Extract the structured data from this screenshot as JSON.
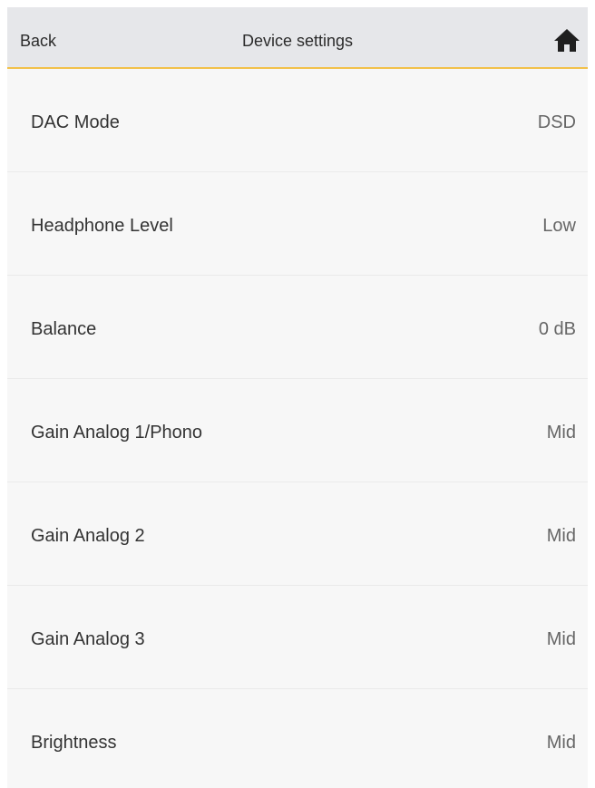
{
  "navbar": {
    "back_label": "Back",
    "title": "Device settings",
    "home_icon": "home-icon",
    "accent_color": "#f2c14a"
  },
  "settings": [
    {
      "label": "DAC Mode",
      "value": "DSD"
    },
    {
      "label": "Headphone Level",
      "value": "Low"
    },
    {
      "label": "Balance",
      "value": "0 dB"
    },
    {
      "label": "Gain Analog 1/Phono",
      "value": "Mid"
    },
    {
      "label": "Gain Analog 2",
      "value": "Mid"
    },
    {
      "label": "Gain Analog 3",
      "value": "Mid"
    },
    {
      "label": "Brightness",
      "value": "Mid"
    }
  ]
}
